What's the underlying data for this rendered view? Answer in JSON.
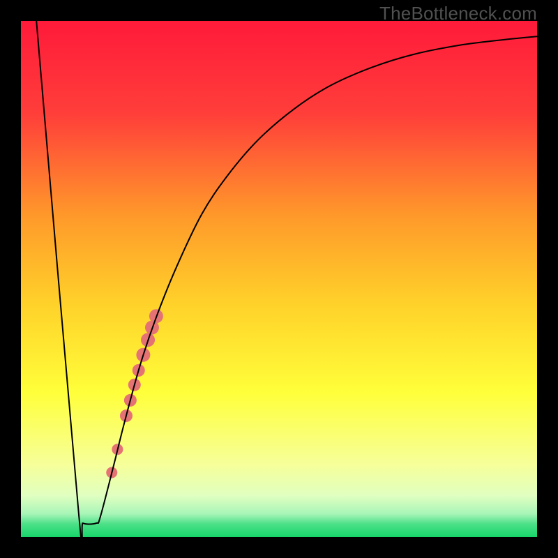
{
  "watermark": "TheBottleneck.com",
  "chart_data": {
    "type": "line",
    "title": "",
    "xlabel": "",
    "ylabel": "",
    "xlim": [
      0,
      100
    ],
    "ylim": [
      0,
      100
    ],
    "grid": false,
    "legend": false,
    "background_gradient": {
      "stops": [
        {
          "offset": 0.0,
          "color": "#ff1a3a"
        },
        {
          "offset": 0.18,
          "color": "#ff3e3a"
        },
        {
          "offset": 0.38,
          "color": "#ff9a2a"
        },
        {
          "offset": 0.55,
          "color": "#ffd22a"
        },
        {
          "offset": 0.72,
          "color": "#ffff3a"
        },
        {
          "offset": 0.86,
          "color": "#f6ff9a"
        },
        {
          "offset": 0.92,
          "color": "#e0ffc0"
        },
        {
          "offset": 0.955,
          "color": "#a8f5b8"
        },
        {
          "offset": 0.975,
          "color": "#4be087"
        },
        {
          "offset": 1.0,
          "color": "#17d66a"
        }
      ]
    },
    "series": [
      {
        "name": "bottleneck-curve",
        "color": "#000000",
        "width": 2,
        "points": [
          {
            "x": 3.0,
            "y": 100.0
          },
          {
            "x": 11.2,
            "y": 4.5
          },
          {
            "x": 12.0,
            "y": 2.7
          },
          {
            "x": 14.6,
            "y": 2.7
          },
          {
            "x": 15.4,
            "y": 4.0
          },
          {
            "x": 18.0,
            "y": 14.0
          },
          {
            "x": 20.0,
            "y": 22.0
          },
          {
            "x": 23.0,
            "y": 33.0
          },
          {
            "x": 26.0,
            "y": 42.0
          },
          {
            "x": 30.0,
            "y": 52.0
          },
          {
            "x": 35.0,
            "y": 62.5
          },
          {
            "x": 40.0,
            "y": 70.0
          },
          {
            "x": 46.0,
            "y": 77.0
          },
          {
            "x": 53.0,
            "y": 83.0
          },
          {
            "x": 60.0,
            "y": 87.5
          },
          {
            "x": 68.0,
            "y": 91.0
          },
          {
            "x": 76.0,
            "y": 93.5
          },
          {
            "x": 85.0,
            "y": 95.3
          },
          {
            "x": 93.0,
            "y": 96.3
          },
          {
            "x": 100.0,
            "y": 97.0
          }
        ]
      }
    ],
    "markers": {
      "name": "highlighted-points",
      "color": "#e57373",
      "points": [
        {
          "x": 17.6,
          "y": 12.5,
          "r": 8
        },
        {
          "x": 18.7,
          "y": 17.0,
          "r": 8
        },
        {
          "x": 20.4,
          "y": 23.5,
          "r": 9
        },
        {
          "x": 21.2,
          "y": 26.5,
          "r": 9
        },
        {
          "x": 22.0,
          "y": 29.5,
          "r": 9
        },
        {
          "x": 22.8,
          "y": 32.3,
          "r": 9
        },
        {
          "x": 23.7,
          "y": 35.3,
          "r": 10
        },
        {
          "x": 24.6,
          "y": 38.2,
          "r": 10
        },
        {
          "x": 25.4,
          "y": 40.6,
          "r": 10
        },
        {
          "x": 26.2,
          "y": 42.8,
          "r": 10
        }
      ]
    }
  }
}
